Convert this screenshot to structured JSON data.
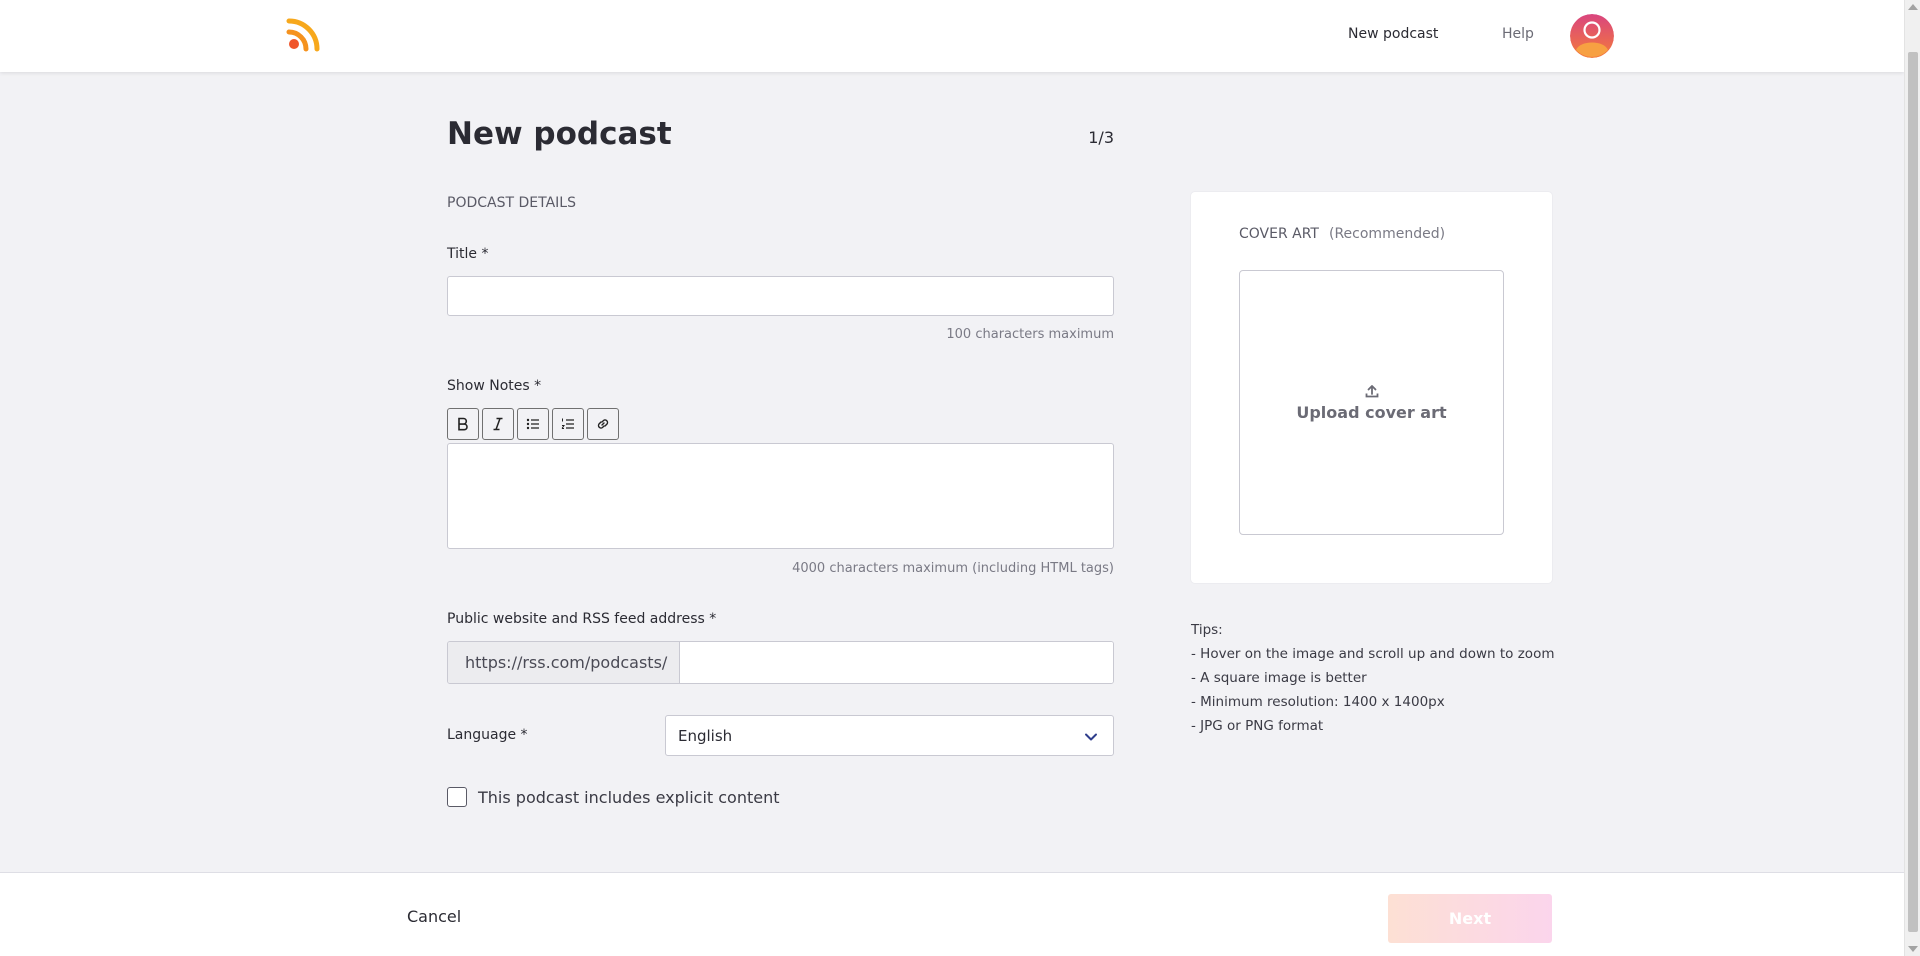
{
  "header": {
    "nav": {
      "new_podcast": "New podcast",
      "help": "Help"
    },
    "logo_icon": "rss-icon",
    "avatar_icon": "user-avatar-icon"
  },
  "page": {
    "title": "New podcast",
    "step": "1/3",
    "section_label": "PODCAST DETAILS"
  },
  "form": {
    "title_label": "Title",
    "title_value": "",
    "title_hint": "100 characters maximum",
    "notes_label": "Show Notes",
    "notes_value": "",
    "notes_hint": "4000 characters maximum (including HTML tags)",
    "toolbar": [
      "bold-icon",
      "italic-icon",
      "bullet-list-icon",
      "numbered-list-icon",
      "link-icon"
    ],
    "url_label": "Public website and RSS feed address",
    "url_prefix": "https://rss.com/podcasts/",
    "url_value": "",
    "language_label": "Language",
    "language_value": "English",
    "explicit_label": "This podcast includes explicit content",
    "required_mark": "*"
  },
  "cover_art": {
    "title": "COVER ART",
    "recommended": "(Recommended)",
    "upload_label": "Upload cover art"
  },
  "tips": {
    "heading": "Tips:",
    "items": [
      "- Hover on the image and scroll up and down to zoom",
      "- A square image is better",
      "- Minimum resolution: 1400 x 1400px",
      "- JPG or PNG format"
    ]
  },
  "footer": {
    "cancel": "Cancel",
    "next": "Next"
  },
  "colors": {
    "brand_orange": "#f5921e",
    "avatar_gradient_start": "#f47a3a",
    "avatar_gradient_end": "#d9457f",
    "next_gradient_start": "#fde0d4",
    "next_gradient_end": "#fbd5ec"
  }
}
